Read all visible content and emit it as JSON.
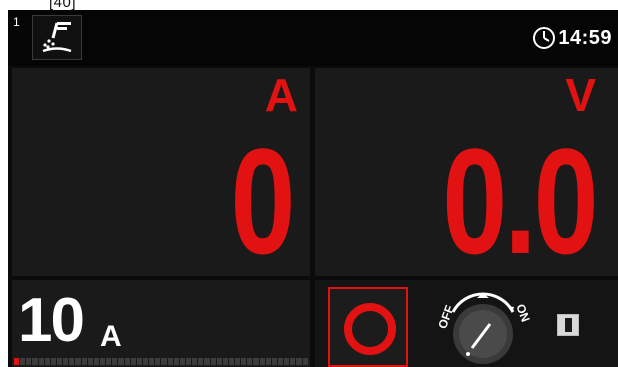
{
  "top_label": "[40]",
  "header": {
    "mode_number": "1",
    "mode_icon": "tig-torch-icon",
    "clock_icon": "clock-icon",
    "time": "14:59"
  },
  "amperage_panel": {
    "unit": "A",
    "value": "0"
  },
  "voltage_panel": {
    "unit": "V",
    "value": "0.0"
  },
  "current_setting": {
    "value": "10",
    "unit": "A",
    "level_fraction": 0.02,
    "segments": 48
  },
  "controls": {
    "stop_icon": "stop-ring-icon",
    "knob": {
      "off_label": "OFF",
      "on_label": "ON"
    },
    "pause_icon": "pause-icon"
  },
  "colors": {
    "accent_red": "#e21212",
    "background": "#0b0b0b",
    "panel": "#1a1a1a",
    "text": "#ffffff"
  }
}
